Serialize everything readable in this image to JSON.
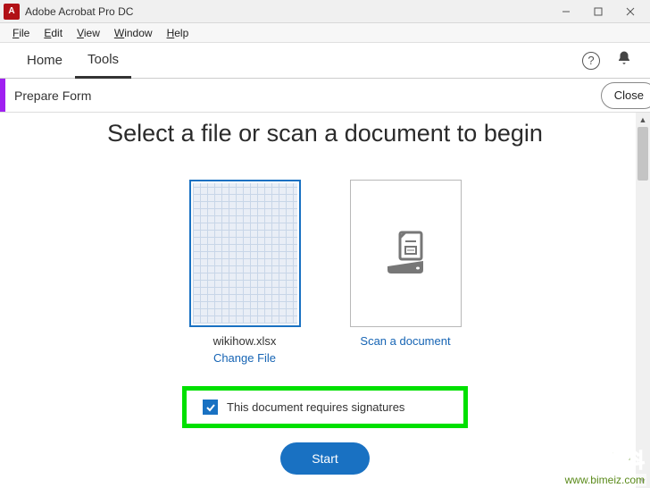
{
  "window": {
    "title": "Adobe Acrobat Pro DC",
    "app_icon_glyph": "A"
  },
  "menubar": {
    "items": [
      "File",
      "Edit",
      "View",
      "Window",
      "Help"
    ]
  },
  "tabs": {
    "home": "Home",
    "tools": "Tools"
  },
  "subheader": {
    "label": "Prepare Form",
    "close_label": "Close"
  },
  "main": {
    "heading": "Select a file or scan a document to begin",
    "file_card": {
      "filename": "wikihow.xlsx",
      "change_link": "Change File"
    },
    "scan_card": {
      "link": "Scan a document"
    },
    "checkbox": {
      "checked": true,
      "label": "This document requires signatures"
    },
    "start_label": "Start"
  },
  "watermark": {
    "cn": "生活百科",
    "url": "www.bimeiz.com"
  }
}
